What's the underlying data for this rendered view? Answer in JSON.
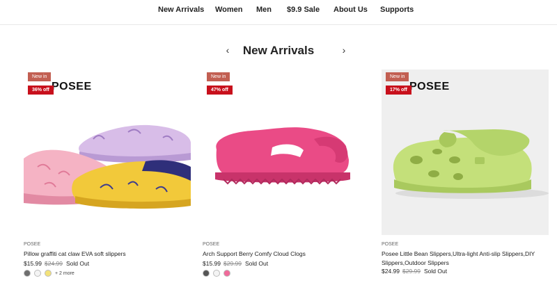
{
  "nav": {
    "items": [
      "New Arrivals",
      "Women",
      "Men",
      "$9.9 Sale",
      "About Us",
      "Supports"
    ]
  },
  "section": {
    "title": "New Arrivals",
    "prev_icon": "chevron-left-icon",
    "next_icon": "chevron-right-icon"
  },
  "products": [
    {
      "brand_logo": "POSEE",
      "badge_new": "New in",
      "badge_discount": "36% off",
      "vendor": "POSEE",
      "title": "Pillow graffiti cat claw EVA soft slippers",
      "price": "$15.99",
      "compare_price": "$24.99",
      "status": "Sold Out",
      "swatches": [
        "#6e6e6e",
        "#f4f4f4",
        "#f3e27a"
      ],
      "more": "+ 2 more"
    },
    {
      "brand_logo": "",
      "badge_new": "New in",
      "badge_discount": "47% off",
      "vendor": "POSEE",
      "title": "Arch Support Berry Comfy Cloud Clogs",
      "price": "$15.99",
      "compare_price": "$29.99",
      "status": "Sold Out",
      "swatches": [
        "#555555",
        "#f4f4f4",
        "#f06a9a"
      ],
      "more": ""
    },
    {
      "brand_logo": "POSEE",
      "badge_new": "New in",
      "badge_discount": "17% off",
      "vendor": "POSEE",
      "title": "Posee Little Bean Slippers,Ultra-light Anti-slip Slippers,DIY Slippers,Outdoor Slippers",
      "price": "$24.99",
      "compare_price": "$29.99",
      "status": "Sold Out",
      "swatches": [],
      "more": ""
    }
  ],
  "colors": {
    "badge_new": "#c25f52",
    "badge_discount": "#c8101c",
    "clog_pink": "#ea4b86",
    "clog_lime": "#c4e07a"
  }
}
